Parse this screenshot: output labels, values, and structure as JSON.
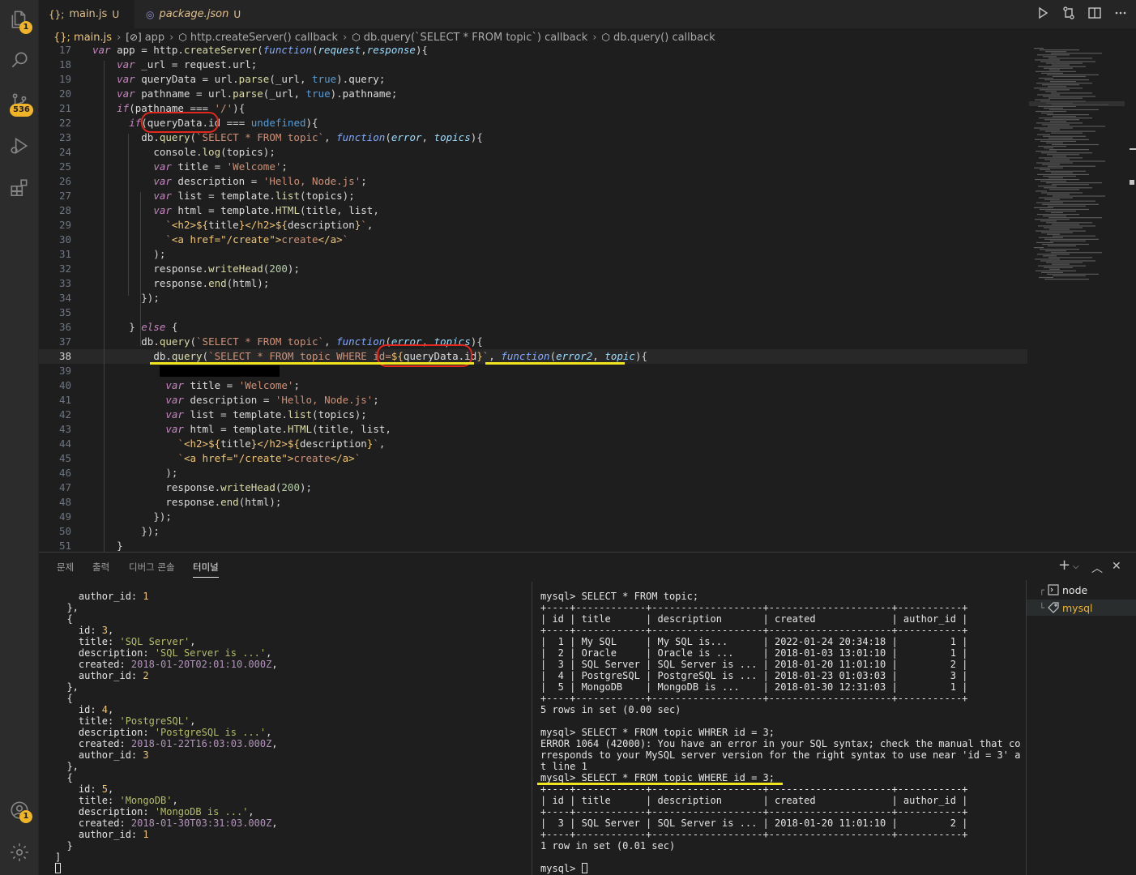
{
  "activity_bar": {
    "explorer_badge": "1",
    "scm_badge": "536",
    "accounts_badge": "1"
  },
  "tabs": [
    {
      "icon": "{};",
      "name": "main.js",
      "status": "U",
      "dirty": true
    },
    {
      "icon": "◎",
      "name": "package.json",
      "status": "U",
      "dirty": false
    }
  ],
  "breadcrumb": [
    "{}; main.js",
    "app",
    "http.createServer() callback",
    "db.query(`SELECT * FROM topic`) callback",
    "db.query() callback"
  ],
  "editor": {
    "current_line": "38",
    "lines": [
      {
        "n": "17",
        "t": "var app = http.createServer(function(request,response){"
      },
      {
        "n": "18",
        "t": "    var _url = request.url;"
      },
      {
        "n": "19",
        "t": "    var queryData = url.parse(_url, true).query;"
      },
      {
        "n": "20",
        "t": "    var pathname = url.parse(_url, true).pathname;"
      },
      {
        "n": "21",
        "t": "    if(pathname === '/'){"
      },
      {
        "n": "22",
        "t": "      if(queryData.id === undefined){"
      },
      {
        "n": "23",
        "t": "        db.query(`SELECT * FROM topic`, function(error, topics){"
      },
      {
        "n": "24",
        "t": "          console.log(topics);"
      },
      {
        "n": "25",
        "t": "          var title = 'Welcome';"
      },
      {
        "n": "26",
        "t": "          var description = 'Hello, Node.js';"
      },
      {
        "n": "27",
        "t": "          var list = template.list(topics);"
      },
      {
        "n": "28",
        "t": "          var html = template.HTML(title, list,"
      },
      {
        "n": "29",
        "t": "            `<h2>${title}</h2>${description}`,"
      },
      {
        "n": "30",
        "t": "            `<a href=\"/create\">create</a>`"
      },
      {
        "n": "31",
        "t": "          );"
      },
      {
        "n": "32",
        "t": "          response.writeHead(200);"
      },
      {
        "n": "33",
        "t": "          response.end(html);"
      },
      {
        "n": "34",
        "t": "        });"
      },
      {
        "n": "35",
        "t": ""
      },
      {
        "n": "36",
        "t": "      } else {"
      },
      {
        "n": "37",
        "t": "        db.query(`SELECT * FROM topic`, function(error, topics){"
      },
      {
        "n": "38",
        "t": "          db.query(`SELECT * FROM topic WHERE id=${queryData.id}`, function(error2, topic){"
      },
      {
        "n": "39",
        "t": ""
      },
      {
        "n": "40",
        "t": "            var title = 'Welcome';"
      },
      {
        "n": "41",
        "t": "            var description = 'Hello, Node.js';"
      },
      {
        "n": "42",
        "t": "            var list = template.list(topics);"
      },
      {
        "n": "43",
        "t": "            var html = template.HTML(title, list,"
      },
      {
        "n": "44",
        "t": "              `<h2>${title}</h2>${description}`,"
      },
      {
        "n": "45",
        "t": "              `<a href=\"/create\">create</a>`"
      },
      {
        "n": "46",
        "t": "            );"
      },
      {
        "n": "47",
        "t": "            response.writeHead(200);"
      },
      {
        "n": "48",
        "t": "            response.end(html);"
      },
      {
        "n": "49",
        "t": "          });"
      },
      {
        "n": "50",
        "t": "        });"
      },
      {
        "n": "51",
        "t": "    }"
      }
    ]
  },
  "panel": {
    "tabs": [
      "문제",
      "출력",
      "디버그 콘솔",
      "터미널"
    ],
    "active_tab": "터미널",
    "terminal_left": [
      "    author_id: 1",
      "  },",
      "  {",
      "    id: 3,",
      "    title: 'SQL Server',",
      "    description: 'SQL Server is ...',",
      "    created: 2018-01-20T02:01:10.000Z,",
      "    author_id: 2",
      "  },",
      "  {",
      "    id: 4,",
      "    title: 'PostgreSQL',",
      "    description: 'PostgreSQL is ...',",
      "    created: 2018-01-22T16:03:03.000Z,",
      "    author_id: 3",
      "  },",
      "  {",
      "    id: 5,",
      "    title: 'MongoDB',",
      "    description: 'MongoDB is ...',",
      "    created: 2018-01-30T03:31:03.000Z,",
      "    author_id: 1",
      "  }",
      "]"
    ],
    "terminal_right": [
      "mysql> SELECT * FROM topic;",
      "+----+------------+-------------------+---------------------+-----------+",
      "| id | title      | description       | created             | author_id |",
      "+----+------------+-------------------+---------------------+-----------+",
      "|  1 | My SQL     | My SQL is...      | 2022-01-24 20:34:18 |         1 |",
      "|  2 | Oracle     | Oracle is ...     | 2018-01-03 13:01:10 |         1 |",
      "|  3 | SQL Server | SQL Server is ... | 2018-01-20 11:01:10 |         2 |",
      "|  4 | PostgreSQL | PostgreSQL is ... | 2018-01-23 01:03:03 |         3 |",
      "|  5 | MongoDB    | MongoDB is ...    | 2018-01-30 12:31:03 |         1 |",
      "+----+------------+-------------------+---------------------+-----------+",
      "5 rows in set (0.00 sec)",
      "",
      "mysql> SELECT * FROM topic WHRER id = 3;",
      "ERROR 1064 (42000): You have an error in your SQL syntax; check the manual that co",
      "rresponds to your MySQL server version for the right syntax to use near 'id = 3' a",
      "t line 1",
      "mysql> SELECT * FROM topic WHERE id = 3;",
      "+----+------------+-------------------+---------------------+-----------+",
      "| id | title      | description       | created             | author_id |",
      "+----+------------+-------------------+---------------------+-----------+",
      "|  3 | SQL Server | SQL Server is ... | 2018-01-20 11:01:10 |         2 |",
      "+----+------------+-------------------+---------------------+-----------+",
      "1 row in set (0.01 sec)",
      "",
      "mysql> "
    ],
    "terminal_list": [
      {
        "name": "node",
        "selected": false
      },
      {
        "name": "mysql",
        "selected": true
      }
    ]
  },
  "colors": {
    "accent_badge": "#f0b429",
    "annotation_circle": "#e0281e",
    "annotation_underline": "#f0e41f",
    "modified": "#e2c08d"
  }
}
